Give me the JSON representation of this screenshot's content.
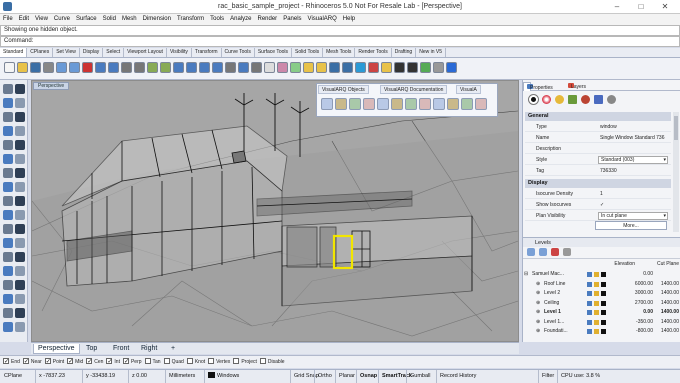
{
  "window": {
    "title": "rac_basic_sample_project - Rhinoceros 5.0 Not For Resale Lab - [Perspective]"
  },
  "menu": [
    "File",
    "Edit",
    "View",
    "Curve",
    "Surface",
    "Solid",
    "Mesh",
    "Dimension",
    "Transform",
    "Tools",
    "Analyze",
    "Render",
    "Panels",
    "VisualARQ",
    "Help"
  ],
  "command": {
    "history": "Showing one hidden object.",
    "prompt": "Command:"
  },
  "toolbar_tabs": [
    "Standard",
    "CPlanes",
    "Set View",
    "Display",
    "Select",
    "Viewport Layout",
    "Visibility",
    "Transform",
    "Curve Tools",
    "Surface Tools",
    "Solid Tools",
    "Mesh Tools",
    "Render Tools",
    "Drafting",
    "New in V5"
  ],
  "viewport": {
    "label": "Perspective",
    "dialog_tabs": [
      "VisualARQ Objects",
      "VisualARQ Documentation",
      "VisualA"
    ]
  },
  "viewport_tabs": [
    "Perspective",
    "Top",
    "Front",
    "Right"
  ],
  "osnap": [
    {
      "label": "End",
      "checked": true
    },
    {
      "label": "Near",
      "checked": true
    },
    {
      "label": "Point",
      "checked": true
    },
    {
      "label": "Mid",
      "checked": true
    },
    {
      "label": "Cen",
      "checked": true
    },
    {
      "label": "Int",
      "checked": true
    },
    {
      "label": "Perp",
      "checked": true
    },
    {
      "label": "Tan",
      "checked": false
    },
    {
      "label": "Quad",
      "checked": false
    },
    {
      "label": "Knot",
      "checked": false
    },
    {
      "label": "Vertex",
      "checked": false
    },
    {
      "label": "Project",
      "checked": false
    },
    {
      "label": "Disable",
      "checked": false
    }
  ],
  "status": {
    "cplane": "CPlane",
    "x": "x -7837.23",
    "y": "y -33438.19",
    "z": "z 0.00",
    "units": "Millimeters",
    "layer": "Windows",
    "buttons": [
      "Grid Snap",
      "Ortho",
      "Planar",
      "Osnap",
      "SmartTrack",
      "Gumball",
      "Record History",
      "Filter"
    ],
    "cpu": "CPU use: 3.8 %"
  },
  "properties": {
    "tabs": [
      "Properties",
      "Layers"
    ],
    "general_header": "General",
    "rows": [
      {
        "k": "Type",
        "v": "window"
      },
      {
        "k": "Name",
        "v": "Single Window Standard 736"
      },
      {
        "k": "Description",
        "v": ""
      },
      {
        "k": "Style",
        "v": "Standard (003)"
      },
      {
        "k": "Tag",
        "v": "736330"
      }
    ],
    "display_header": "Display",
    "display_rows": [
      {
        "k": "Isocurve Density",
        "v": "1"
      },
      {
        "k": "Show Isocurves",
        "v": "✓"
      },
      {
        "k": "Plan Visibility",
        "v": "In cut plane"
      }
    ],
    "more": "More..."
  },
  "levels": {
    "title": "Levels",
    "columns": {
      "elevation": "Elevation",
      "cut_plane": "Cut Plane"
    },
    "rows": [
      {
        "name": "Samuel Mac...",
        "elev": "0.00",
        "cut": "",
        "indent": 0,
        "bold": false
      },
      {
        "name": "Roof Line",
        "elev": "6000.00",
        "cut": "1400.00",
        "indent": 1,
        "bold": false
      },
      {
        "name": "Level 2",
        "elev": "3000.00",
        "cut": "1400.00",
        "indent": 1,
        "bold": false
      },
      {
        "name": "Ceiling",
        "elev": "2700.00",
        "cut": "1400.00",
        "indent": 1,
        "bold": false
      },
      {
        "name": "Level 1",
        "elev": "0.00",
        "cut": "1400.00",
        "indent": 1,
        "bold": true
      },
      {
        "name": "Level 1...",
        "elev": "-350.00",
        "cut": "1400.00",
        "indent": 1,
        "bold": false
      },
      {
        "name": "Foundati...",
        "elev": "-800.00",
        "cut": "1400.00",
        "indent": 1,
        "bold": false
      }
    ]
  },
  "colors": {
    "selection": "#f2e600",
    "accent": "#3a6ea5"
  }
}
